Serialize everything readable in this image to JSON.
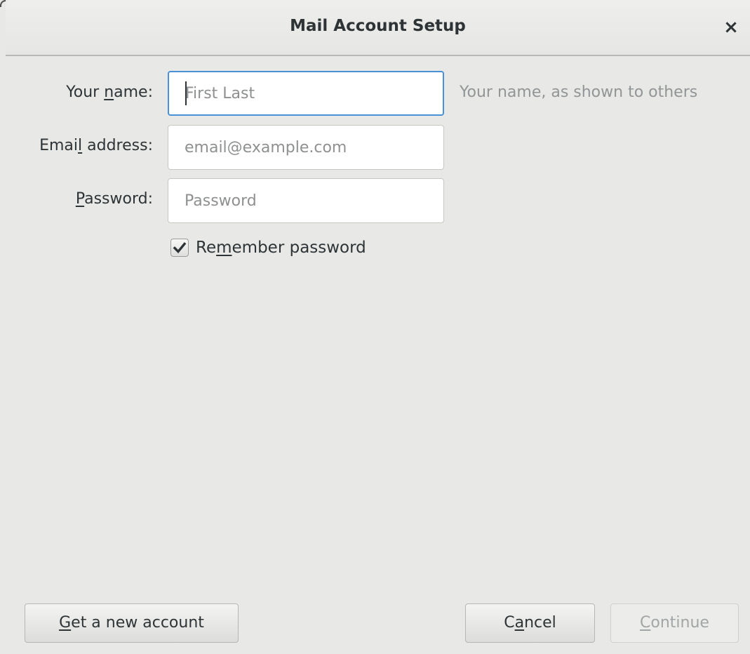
{
  "window": {
    "title": "Mail Account Setup",
    "close_icon": "close-icon"
  },
  "form": {
    "name": {
      "label_pre": "Your ",
      "label_mnemonic": "n",
      "label_post": "ame:",
      "placeholder": "First Last",
      "value": "",
      "hint": "Your name, as shown to others"
    },
    "email": {
      "label_pre": "Emai",
      "label_mnemonic": "l",
      "label_post": " address:",
      "placeholder": "email@example.com",
      "value": ""
    },
    "password": {
      "label_pre": "",
      "label_mnemonic": "P",
      "label_post": "assword:",
      "placeholder": "Password",
      "value": ""
    },
    "remember": {
      "checked": true,
      "label_pre": "Re",
      "label_mnemonic": "m",
      "label_post": "ember password"
    }
  },
  "buttons": {
    "new_account": {
      "pre": "",
      "mnemonic": "G",
      "post": "et a new account"
    },
    "cancel": {
      "pre": "C",
      "mnemonic": "a",
      "post": "ncel"
    },
    "continue": {
      "pre": "",
      "mnemonic": "C",
      "post": "ontinue",
      "disabled": true
    }
  },
  "colors": {
    "background": "#e8e8e7",
    "focus_border": "#4a90d9",
    "text": "#2e3436",
    "hint_text": "#929595"
  }
}
